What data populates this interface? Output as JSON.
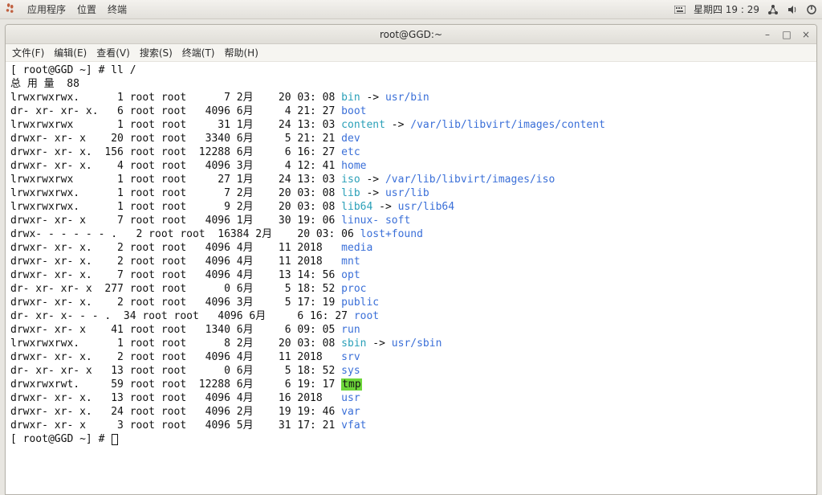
{
  "panel": {
    "app": "应用程序",
    "places": "位置",
    "terminal": "终端",
    "clock": "星期四 19 : 29"
  },
  "window": {
    "title": "root@GGD:~",
    "menu": {
      "file": "文件(F)",
      "edit": "编辑(E)",
      "view": "查看(V)",
      "search": "搜索(S)",
      "terminal": "终端(T)",
      "help": "帮助(H)"
    }
  },
  "term": {
    "prompt1": "[ root@GGD ~] # ll /",
    "totals": "总 用 量  88",
    "prompt2": "[ root@GGD ~] # ",
    "lines": [
      {
        "perm": "lrwxrwxrwx.",
        "links": "1",
        "o": "root",
        "g": "root",
        "size": "7",
        "mon": "2月",
        "day": "20",
        "time": "03: 08",
        "name": "bin",
        "link": "usr/bin"
      },
      {
        "perm": "dr- xr- xr- x.",
        "links": "6",
        "o": "root",
        "g": "root",
        "size": "4096",
        "mon": "6月",
        "day": "4",
        "time": "21: 27",
        "name": "boot"
      },
      {
        "perm": "lrwxrwxrwx",
        "links": "1",
        "o": "root",
        "g": "root",
        "size": "31",
        "mon": "1月",
        "day": "24",
        "time": "13: 03",
        "name": "content",
        "link": "/var/lib/libvirt/images/content"
      },
      {
        "perm": "drwxr- xr- x",
        "links": "20",
        "o": "root",
        "g": "root",
        "size": "3340",
        "mon": "6月",
        "day": "5",
        "time": "21: 21",
        "name": "dev"
      },
      {
        "perm": "drwxr- xr- x.",
        "links": "156",
        "o": "root",
        "g": "root",
        "size": "12288",
        "mon": "6月",
        "day": "6",
        "time": "16: 27",
        "name": "etc"
      },
      {
        "perm": "drwxr- xr- x.",
        "links": "4",
        "o": "root",
        "g": "root",
        "size": "4096",
        "mon": "3月",
        "day": "4",
        "time": "12: 41",
        "name": "home"
      },
      {
        "perm": "lrwxrwxrwx",
        "links": "1",
        "o": "root",
        "g": "root",
        "size": "27",
        "mon": "1月",
        "day": "24",
        "time": "13: 03",
        "name": "iso",
        "link": "/var/lib/libvirt/images/iso"
      },
      {
        "perm": "lrwxrwxrwx.",
        "links": "1",
        "o": "root",
        "g": "root",
        "size": "7",
        "mon": "2月",
        "day": "20",
        "time": "03: 08",
        "name": "lib",
        "link": "usr/lib"
      },
      {
        "perm": "lrwxrwxrwx.",
        "links": "1",
        "o": "root",
        "g": "root",
        "size": "9",
        "mon": "2月",
        "day": "20",
        "time": "03: 08",
        "name": "lib64",
        "link": "usr/lib64"
      },
      {
        "perm": "drwxr- xr- x",
        "links": "7",
        "o": "root",
        "g": "root",
        "size": "4096",
        "mon": "1月",
        "day": "30",
        "time": "19: 06",
        "name": "linux- soft"
      },
      {
        "perm": "drwx- - - - - - .",
        "links": "2",
        "o": "root",
        "g": "root",
        "size": "16384",
        "mon": "2月",
        "day": "20",
        "time": "03: 06",
        "name": "lost+found"
      },
      {
        "perm": "drwxr- xr- x.",
        "links": "2",
        "o": "root",
        "g": "root",
        "size": "4096",
        "mon": "4月",
        "day": "11",
        "time": "2018",
        "name": "media"
      },
      {
        "perm": "drwxr- xr- x.",
        "links": "2",
        "o": "root",
        "g": "root",
        "size": "4096",
        "mon": "4月",
        "day": "11",
        "time": "2018",
        "name": "mnt"
      },
      {
        "perm": "drwxr- xr- x.",
        "links": "7",
        "o": "root",
        "g": "root",
        "size": "4096",
        "mon": "4月",
        "day": "13",
        "time": "14: 56",
        "name": "opt"
      },
      {
        "perm": "dr- xr- xr- x",
        "links": "277",
        "o": "root",
        "g": "root",
        "size": "0",
        "mon": "6月",
        "day": "5",
        "time": "18: 52",
        "name": "proc"
      },
      {
        "perm": "drwxr- xr- x.",
        "links": "2",
        "o": "root",
        "g": "root",
        "size": "4096",
        "mon": "3月",
        "day": "5",
        "time": "17: 19",
        "name": "public"
      },
      {
        "perm": "dr- xr- x- - - .",
        "links": "34",
        "o": "root",
        "g": "root",
        "size": "4096",
        "mon": "6月",
        "day": "6",
        "time": "16: 27",
        "name": "root"
      },
      {
        "perm": "drwxr- xr- x",
        "links": "41",
        "o": "root",
        "g": "root",
        "size": "1340",
        "mon": "6月",
        "day": "6",
        "time": "09: 05",
        "name": "run"
      },
      {
        "perm": "lrwxrwxrwx.",
        "links": "1",
        "o": "root",
        "g": "root",
        "size": "8",
        "mon": "2月",
        "day": "20",
        "time": "03: 08",
        "name": "sbin",
        "link": "usr/sbin"
      },
      {
        "perm": "drwxr- xr- x.",
        "links": "2",
        "o": "root",
        "g": "root",
        "size": "4096",
        "mon": "4月",
        "day": "11",
        "time": "2018",
        "name": "srv"
      },
      {
        "perm": "dr- xr- xr- x",
        "links": "13",
        "o": "root",
        "g": "root",
        "size": "0",
        "mon": "6月",
        "day": "5",
        "time": "18: 52",
        "name": "sys"
      },
      {
        "perm": "drwxrwxrwt.",
        "links": "59",
        "o": "root",
        "g": "root",
        "size": "12288",
        "mon": "6月",
        "day": "6",
        "time": "19: 17",
        "name": "tmp",
        "sticky": true
      },
      {
        "perm": "drwxr- xr- x.",
        "links": "13",
        "o": "root",
        "g": "root",
        "size": "4096",
        "mon": "4月",
        "day": "16",
        "time": "2018",
        "name": "usr"
      },
      {
        "perm": "drwxr- xr- x.",
        "links": "24",
        "o": "root",
        "g": "root",
        "size": "4096",
        "mon": "2月",
        "day": "19",
        "time": "19: 46",
        "name": "var"
      },
      {
        "perm": "drwxr- xr- x",
        "links": "3",
        "o": "root",
        "g": "root",
        "size": "4096",
        "mon": "5月",
        "day": "31",
        "time": "17: 21",
        "name": "vfat"
      }
    ]
  }
}
